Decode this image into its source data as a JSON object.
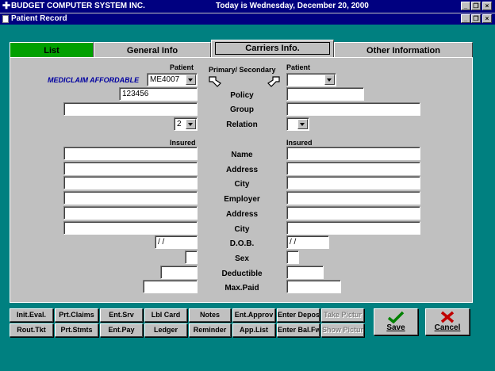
{
  "app": {
    "title": "BUDGET COMPUTER SYSTEM INC.",
    "date": "Today is Wednesday, December 20, 2000"
  },
  "window": {
    "title": "Patient Record"
  },
  "tabs": [
    {
      "label": "List"
    },
    {
      "label": "General Info"
    },
    {
      "label": "Carriers Info."
    },
    {
      "label": "Other Information"
    }
  ],
  "form": {
    "patient_label_left": "Patient",
    "patient_label_right": "Patient",
    "primary_secondary": "Primary/ Secondary",
    "carrier_name": "MEDICLAIM AFFORDABLE",
    "carrier_code": "ME4007",
    "policy_left": "123456",
    "relation_left": "2",
    "insured_left": "Insured",
    "insured_right": "Insured",
    "dob_left": "/ /",
    "dob_right": "/ /",
    "labels": {
      "policy": "Policy",
      "group": "Group",
      "relation": "Relation",
      "name": "Name",
      "address": "Address",
      "city": "City",
      "employer": "Employer",
      "address2": "Address",
      "city2": "City",
      "dob": "D.O.B.",
      "sex": "Sex",
      "deductible": "Deductible",
      "maxpaid": "Max.Paid"
    }
  },
  "buttons": {
    "row1": [
      "Init.Eval.",
      "Prt.Claims",
      "Ent.Srv",
      "Lbl Card",
      "Notes",
      "Ent.Approv",
      "Enter Depos",
      "Take Pictur"
    ],
    "row2": [
      "Rout.Tkt",
      "Prt.Stmts",
      "Ent.Pay",
      "Ledger",
      "Reminder",
      "App.List",
      "Enter Bal.Fw",
      "Show Pictur"
    ],
    "save": "Save",
    "cancel": "Cancel"
  }
}
